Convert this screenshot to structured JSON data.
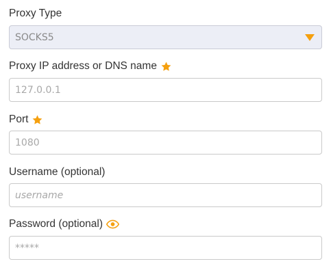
{
  "proxy_type": {
    "label": "Proxy Type",
    "selected": "SOCKS5",
    "icon": "chevron-down-icon",
    "accent": "#f5a00f"
  },
  "proxy_host": {
    "label": "Proxy IP address or DNS name",
    "required_icon": "star-icon",
    "placeholder": "127.0.0.1",
    "value": ""
  },
  "port": {
    "label": "Port",
    "required_icon": "star-icon",
    "placeholder": "1080",
    "value": ""
  },
  "username": {
    "label": "Username (optional)",
    "placeholder": "username",
    "value": ""
  },
  "password": {
    "label": "Password (optional)",
    "visibility_icon": "eye-icon",
    "placeholder": "*****",
    "value": ""
  },
  "colors": {
    "accent": "#f5a00f",
    "select_background": "#eceef6",
    "border": "#c9c9c9"
  }
}
